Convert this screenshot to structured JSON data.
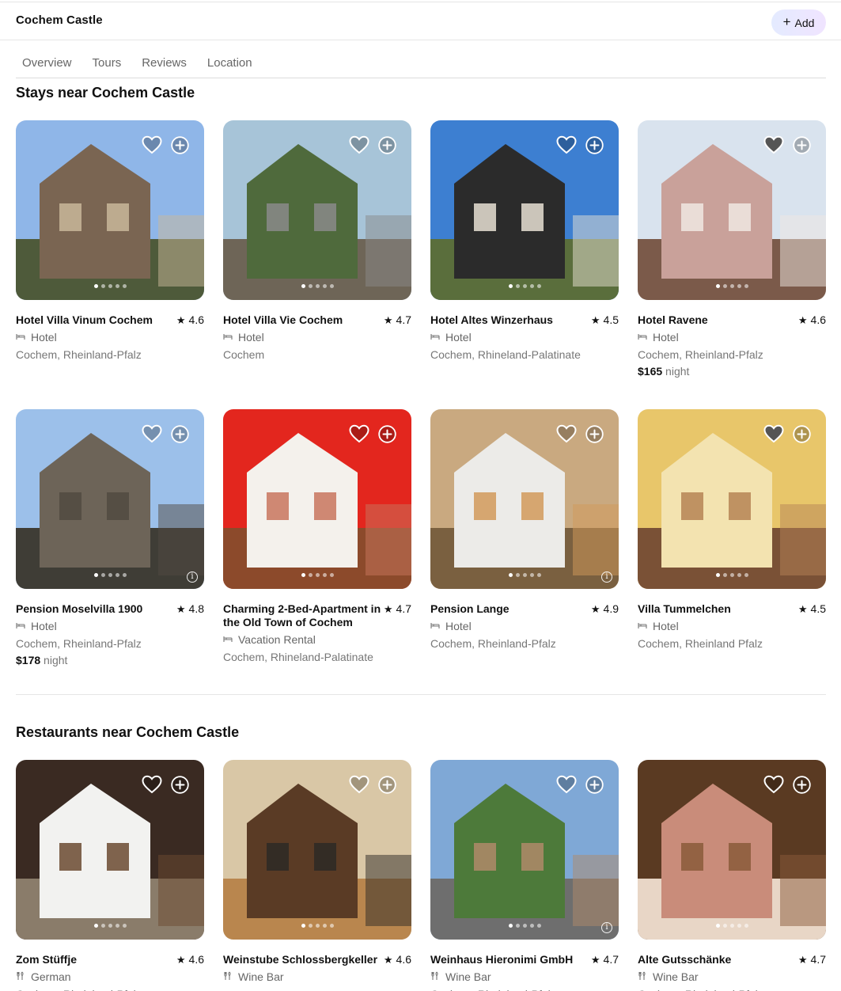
{
  "header": {
    "title": "Cochem Castle",
    "add_label": "Add"
  },
  "tabs": [
    "Overview",
    "Tours",
    "Reviews",
    "Location"
  ],
  "stays": {
    "title": "Stays near Cochem Castle",
    "items": [
      {
        "name": "Hotel Villa Vinum Cochem",
        "rating": "4.6",
        "type": "Hotel",
        "location": "Cochem, Rheinland-Pfalz",
        "price": "",
        "price_unit": "",
        "heart_filled": false,
        "info_icon": false,
        "palette": [
          "#8fb6e8",
          "#7a6552",
          "#c9b79a",
          "#4e5a3a"
        ]
      },
      {
        "name": "Hotel Villa Vie Cochem",
        "rating": "4.7",
        "type": "Hotel",
        "location": "Cochem",
        "price": "",
        "price_unit": "",
        "heart_filled": false,
        "info_icon": false,
        "palette": [
          "#a7c4d8",
          "#4f6a3c",
          "#8a8a8a",
          "#6e6557"
        ]
      },
      {
        "name": "Hotel Altes Winzerhaus",
        "rating": "4.5",
        "type": "Hotel",
        "location": "Cochem, Rhineland-Palatinate",
        "price": "",
        "price_unit": "",
        "heart_filled": false,
        "info_icon": false,
        "palette": [
          "#3d7fd1",
          "#2b2b2b",
          "#e7e1d4",
          "#5a6e3c"
        ]
      },
      {
        "name": "Hotel Ravene",
        "rating": "4.6",
        "type": "Hotel",
        "location": "Cochem, Rheinland-Pfalz",
        "price": "$165",
        "price_unit": "night",
        "heart_filled": true,
        "info_icon": false,
        "palette": [
          "#d9e3ee",
          "#c9a19a",
          "#f0e8e2",
          "#7b5a4a"
        ]
      },
      {
        "name": "Pension Moselvilla 1900",
        "rating": "4.8",
        "type": "Hotel",
        "location": "Cochem, Rheinland-Pfalz",
        "price": "$178",
        "price_unit": "night",
        "heart_filled": false,
        "info_icon": true,
        "palette": [
          "#9cc0ea",
          "#6d6458",
          "#514a41",
          "#3f3d36"
        ]
      },
      {
        "name": "Charming 2-Bed-Apartment in the Old Town of Cochem",
        "rating": "4.7",
        "type": "Vacation Rental",
        "location": "Cochem, Rhineland-Palatinate",
        "price": "",
        "price_unit": "",
        "heart_filled": false,
        "info_icon": false,
        "palette": [
          "#e3261e",
          "#f4f1ec",
          "#c8755e",
          "#8c4a2b"
        ]
      },
      {
        "name": "Pension Lange",
        "rating": "4.9",
        "type": "Hotel",
        "location": "Cochem, Rheinland-Pfalz",
        "price": "",
        "price_unit": "",
        "heart_filled": false,
        "info_icon": true,
        "palette": [
          "#c9a980",
          "#ecebe8",
          "#d29a5a",
          "#7a6040"
        ]
      },
      {
        "name": "Villa Tummelchen",
        "rating": "4.5",
        "type": "Hotel",
        "location": "Cochem, Rheinland Pfalz",
        "price": "",
        "price_unit": "",
        "heart_filled": true,
        "info_icon": false,
        "palette": [
          "#e8c66a",
          "#f3e3b0",
          "#b58455",
          "#7a5136"
        ]
      }
    ]
  },
  "restaurants": {
    "title": "Restaurants near Cochem Castle",
    "items": [
      {
        "name": "Zom Stüffje",
        "rating": "4.6",
        "type": "German",
        "location": "Cochem, Rheinland-Pfalz",
        "heart_filled": false,
        "info_icon": false,
        "palette": [
          "#3a2a22",
          "#f2f2f0",
          "#6b4a30",
          "#8a7c6a"
        ]
      },
      {
        "name": "Weinstube Schlossbergkeller",
        "rating": "4.6",
        "type": "Wine Bar",
        "location": "",
        "heart_filled": false,
        "info_icon": false,
        "palette": [
          "#d9c7a6",
          "#5a3b25",
          "#2d2a26",
          "#b9864e"
        ]
      },
      {
        "name": "Weinhaus Hieronimi GmbH",
        "rating": "4.7",
        "type": "Wine Bar",
        "location": "Cochem, Rheinland-Pfalz",
        "heart_filled": false,
        "info_icon": true,
        "palette": [
          "#7fa8d6",
          "#4d7a3a",
          "#b08a6a",
          "#6e6e6e"
        ]
      },
      {
        "name": "Alte Gutsschänke",
        "rating": "4.7",
        "type": "Wine Bar",
        "location": "Cochem, Rheinland-Pfalz",
        "heart_filled": false,
        "info_icon": false,
        "palette": [
          "#5a3a22",
          "#c98c7a",
          "#8a5a3a",
          "#e8d6c6"
        ]
      }
    ]
  }
}
